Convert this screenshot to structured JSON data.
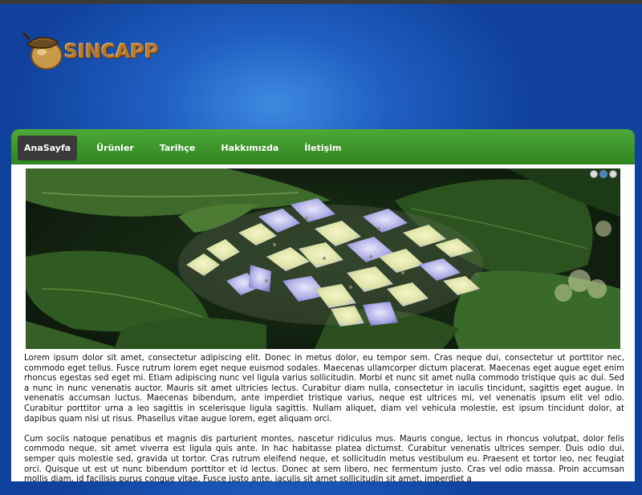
{
  "brand": {
    "name": "SINCAPP"
  },
  "nav": {
    "items": [
      {
        "label": "AnaSayfa"
      },
      {
        "label": "Ürünler"
      },
      {
        "label": "Tarihçe"
      },
      {
        "label": "Hakkımızda"
      },
      {
        "label": "İletişim"
      }
    ],
    "active_index": 0
  },
  "slider": {
    "image_icon": "hydrangea-flower-photo",
    "dots": 3,
    "active_dot": 1
  },
  "content": {
    "paragraphs": [
      "Lorem ipsum dolor sit amet, consectetur adipiscing elit. Donec in metus dolor, eu tempor sem. Cras neque dui, consectetur ut porttitor nec, commodo eget tellus. Fusce rutrum lorem eget neque euismod sodales. Maecenas ullamcorper dictum placerat. Maecenas eget augue eget enim rhoncus egestas sed eget mi. Etiam adipiscing nunc vel ligula varius sollicitudin. Morbi et nunc sit amet nulla commodo tristique quis ac dui. Sed a nunc in nunc venenatis auctor. Mauris sit amet ultricies lectus. Curabitur diam nulla, consectetur in iaculis tincidunt, sagittis eget augue. In venenatis accumsan luctus. Maecenas bibendum, ante imperdiet tristique varius, neque est ultrices mi, vel venenatis ipsum elit vel odio. Curabitur porttitor urna a leo sagittis in scelerisque ligula sagittis. Nullam aliquet, diam vel vehicula molestie, est ipsum tincidunt dolor, at dapibus quam nisi ut risus. Phasellus vitae augue lorem, eget aliquam orci.",
      "Cum sociis natoque penatibus et magnis dis parturient montes, nascetur ridiculus mus. Mauris congue, lectus in rhoncus volutpat, dolor felis commodo neque, sit amet viverra est ligula quis ante. In hac habitasse platea dictumst. Curabitur venenatis ultrices semper. Duis odio dui, semper quis molestie sed, gravida ut tortor. Cras rutrum eleifend neque, et sollicitudin metus vestibulum eu. Praesent et tortor leo, nec feugiat orci. Quisque ut est ut nunc bibendum porttitor et id lectus. Donec at sem libero, nec fermentum justo. Cras vel odio massa. Proin accumsan mollis diam, id facilisis purus congue vitae. Fusce justo ante, iaculis sit amet sollicitudin sit amet, imperdiet a"
    ]
  },
  "colors": {
    "header_blue": "#1f5fc2",
    "nav_green": "#3c9a2c",
    "active_tab": "#3a3a3a",
    "logo_brown": "#b8782a"
  }
}
